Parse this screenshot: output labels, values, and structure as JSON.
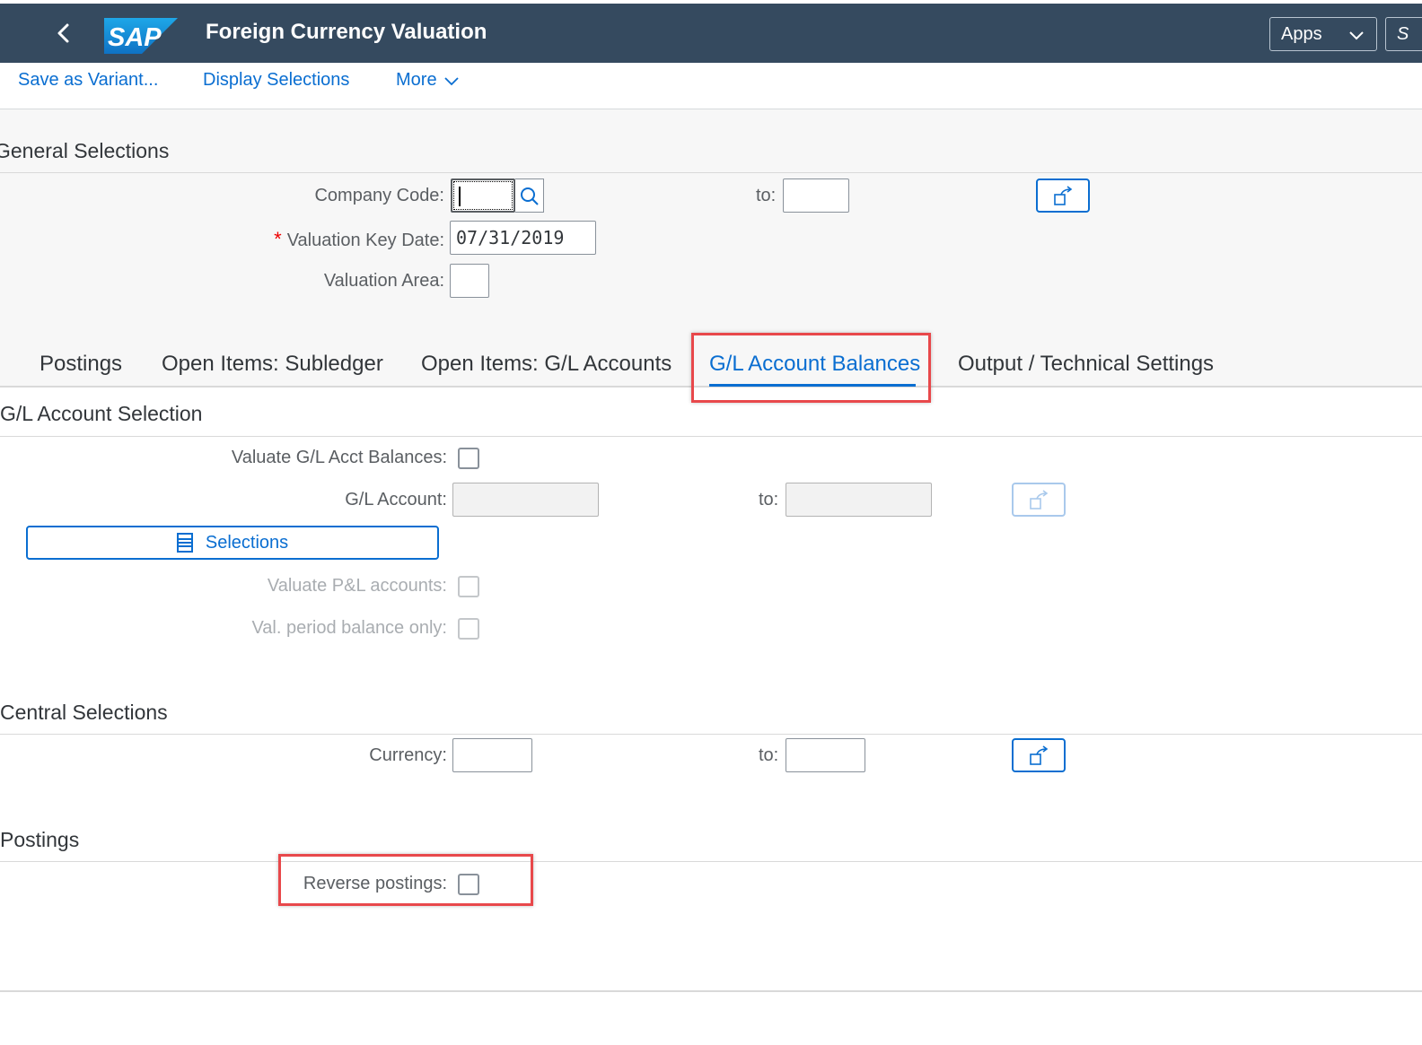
{
  "shell": {
    "title": "Foreign Currency Valuation",
    "logo_text": "SAP",
    "apps_label": "Apps",
    "overflow_label": "S"
  },
  "toolbar": {
    "save_variant": "Save as Variant...",
    "display_selections": "Display Selections",
    "more": "More"
  },
  "general": {
    "title": "General Selections",
    "company_code_label": "Company Code:",
    "company_code_value": "",
    "to_label": "to:",
    "company_code_to_value": "",
    "valuation_key_date_label": "Valuation Key Date:",
    "valuation_key_date_required": "*",
    "valuation_key_date_value": "07/31/2019",
    "valuation_area_label": "Valuation Area:",
    "valuation_area_value": ""
  },
  "tabs": [
    {
      "label": "Postings",
      "active": false
    },
    {
      "label": "Open Items: Subledger",
      "active": false
    },
    {
      "label": "Open Items: G/L Accounts",
      "active": false
    },
    {
      "label": "G/L Account Balances",
      "active": true
    },
    {
      "label": "Output / Technical Settings",
      "active": false
    }
  ],
  "gl_selection": {
    "title": "G/L Account Selection",
    "valuate_balances_label": "Valuate G/L Acct Balances:",
    "valuate_balances_checked": false,
    "gl_account_label": "G/L Account:",
    "gl_account_value": "",
    "to_label": "to:",
    "gl_account_to_value": "",
    "selections_label": "Selections",
    "valuate_pl_label": "Valuate P&L accounts:",
    "val_period_label": "Val. period balance only:"
  },
  "central": {
    "title": "Central Selections",
    "currency_label": "Currency:",
    "currency_value": "",
    "to_label": "to:",
    "currency_to_value": ""
  },
  "postings": {
    "title": "Postings",
    "reverse_label": "Reverse postings:",
    "reverse_checked": false
  },
  "colors": {
    "shell_bg": "#354a5f",
    "accent": "#0a6ed1",
    "highlight": "#e8484b",
    "required": "#ee0000"
  }
}
